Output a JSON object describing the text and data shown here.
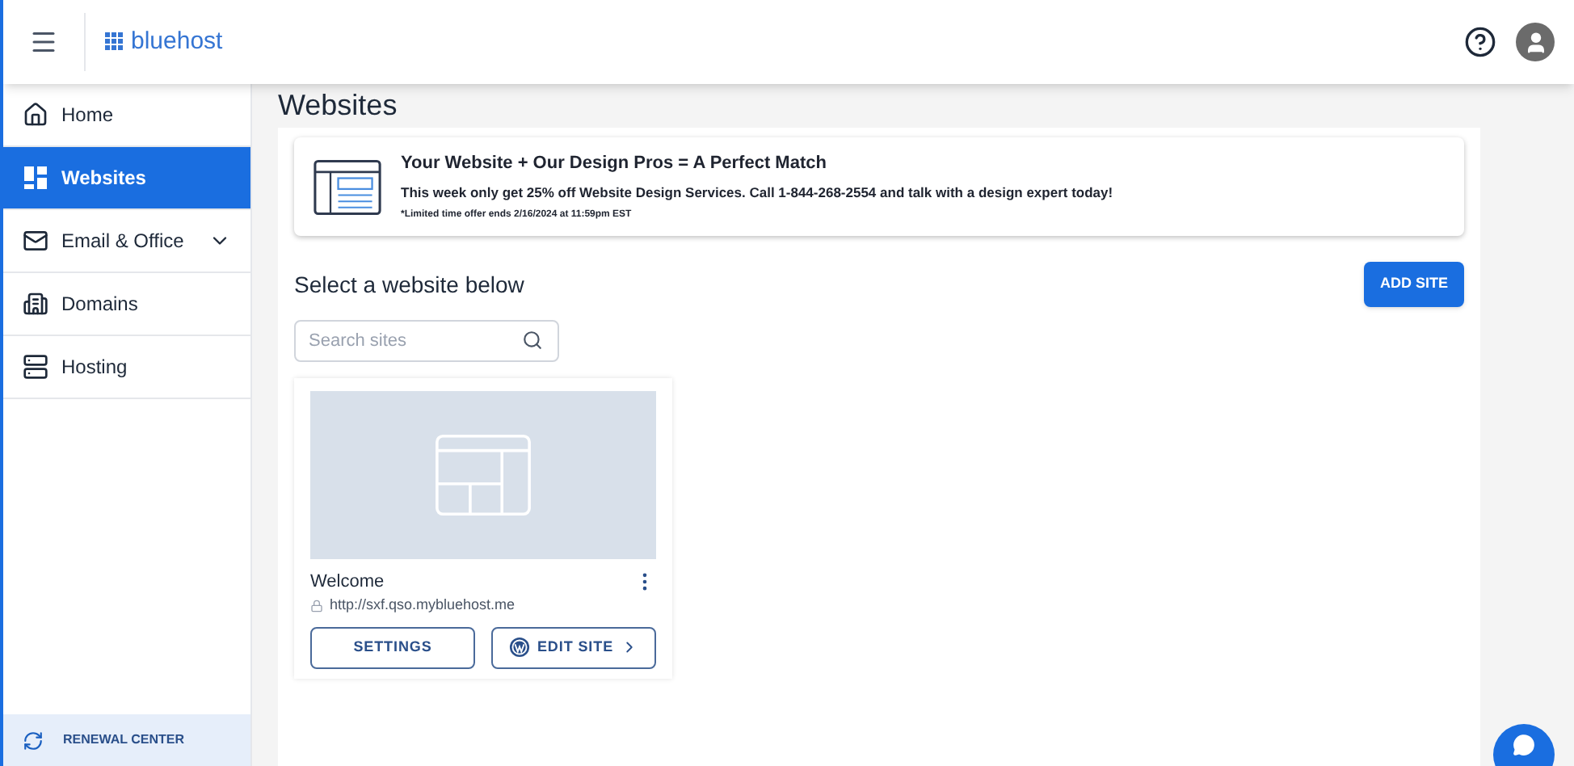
{
  "header": {
    "logo": "bluehost"
  },
  "sidebar": {
    "items": [
      {
        "label": "Home",
        "selected": false,
        "expandable": false
      },
      {
        "label": "Websites",
        "selected": true,
        "expandable": false
      },
      {
        "label": "Email & Office",
        "selected": false,
        "expandable": true
      },
      {
        "label": "Domains",
        "selected": false,
        "expandable": false
      },
      {
        "label": "Hosting",
        "selected": false,
        "expandable": false
      }
    ],
    "footer": "RENEWAL CENTER"
  },
  "page_title": "Websites",
  "promo": {
    "title": "Your Website + Our Design Pros = A Perfect Match",
    "body": "This week only get 25% off Website Design Services. Call 1-844-268-2554 and talk with a design expert today!",
    "note": "*Limited time offer ends 2/16/2024 at 11:59pm EST"
  },
  "section_title": "Select a website below",
  "add_button": "ADD SITE",
  "search": {
    "placeholder": "Search sites"
  },
  "sites": [
    {
      "name": "Welcome",
      "url": "http://sxf.qso.mybluehost.me",
      "buttons": [
        "SETTINGS",
        "EDIT SITE"
      ]
    }
  ]
}
